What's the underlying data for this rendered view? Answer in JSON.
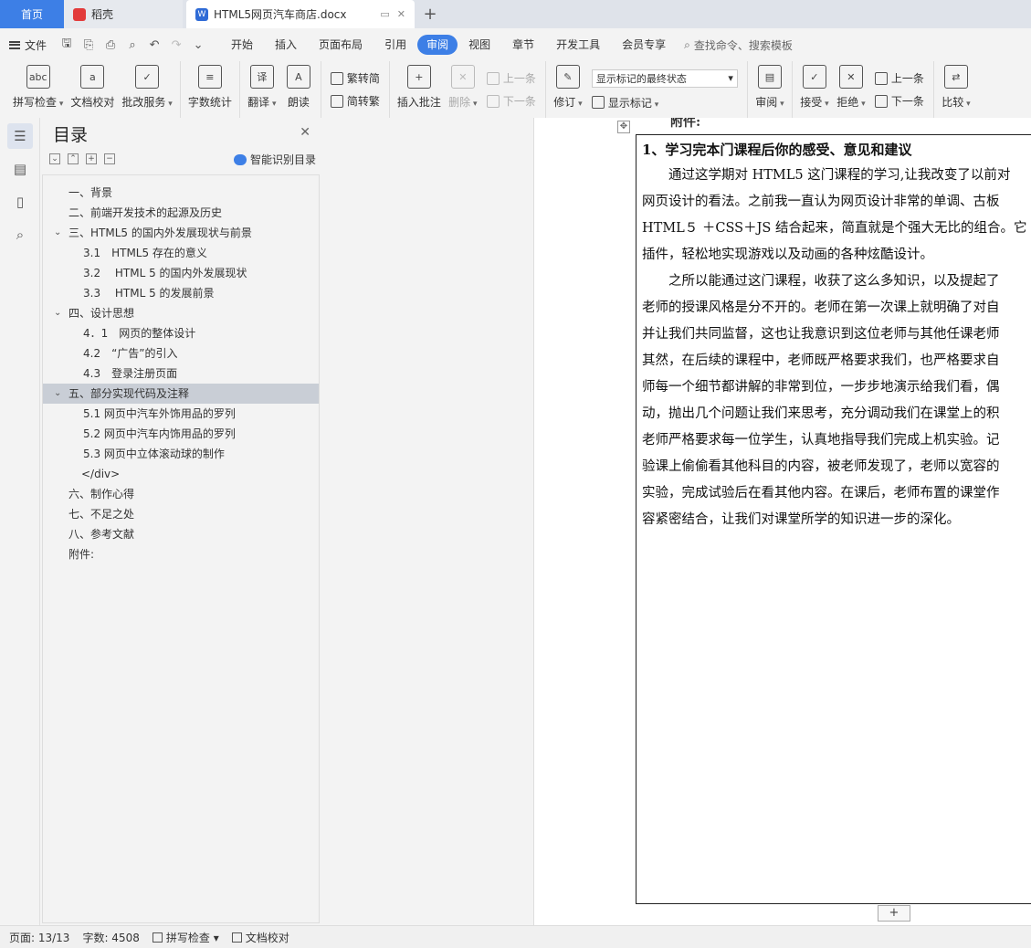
{
  "tabs": {
    "home": "首页",
    "daoke": "稻壳",
    "doc": "HTML5网页汽车商店.docx",
    "plus": "+"
  },
  "menu": {
    "file": "文件",
    "items": [
      "开始",
      "插入",
      "页面布局",
      "引用",
      "审阅",
      "视图",
      "章节",
      "开发工具",
      "会员专享"
    ],
    "active": "审阅",
    "search": "查找命令、搜索模板"
  },
  "ribbon": {
    "spell_check": "拼写检查",
    "doc_proof": "文档校对",
    "batch_service": "批改服务",
    "word_count": "字数统计",
    "translate": "翻译",
    "read_aloud": "朗读",
    "trad_to_simp": "繁转简",
    "simp_to_trad": "简转繁",
    "insert_comment": "插入批注",
    "delete": "删除",
    "prev_comment": "上一条",
    "next_comment": "下一条",
    "revise": "修订",
    "markup_state": "显示标记的最终状态",
    "show_markup": "显示标记",
    "review": "审阅",
    "accept": "接受",
    "reject": "拒绝",
    "prev_change": "上一条",
    "next_change": "下一条",
    "compare": "比较"
  },
  "toc": {
    "title": "目录",
    "smart": "智能识别目录",
    "items": [
      {
        "label": "一、背景",
        "indent": 0,
        "arrow": ""
      },
      {
        "label": "二、前端开发技术的起源及历史",
        "indent": 0,
        "arrow": ""
      },
      {
        "label": "三、HTML5 的国内外发展现状与前景",
        "indent": 0,
        "arrow": "⌄"
      },
      {
        "label": "3.1　HTML5 存在的意义",
        "indent": 1,
        "arrow": ""
      },
      {
        "label": "3.2　 HTML 5 的国内外发展现状",
        "indent": 1,
        "arrow": ""
      },
      {
        "label": "3.3　 HTML 5 的发展前景",
        "indent": 1,
        "arrow": ""
      },
      {
        "label": "四、设计思想",
        "indent": 0,
        "arrow": "⌄"
      },
      {
        "label": "4．1　网页的整体设计",
        "indent": 1,
        "arrow": ""
      },
      {
        "label": "4.2　“广告”的引入",
        "indent": 1,
        "arrow": ""
      },
      {
        "label": "4.3　登录注册页面",
        "indent": 1,
        "arrow": ""
      },
      {
        "label": "五、部分实现代码及注释",
        "indent": 0,
        "arrow": "⌄",
        "selected": true
      },
      {
        "label": "5.1 网页中汽车外饰用品的罗列",
        "indent": 1,
        "arrow": ""
      },
      {
        "label": "5.2 网页中汽车内饰用品的罗列",
        "indent": 1,
        "arrow": ""
      },
      {
        "label": "5.3 网页中立体滚动球的制作",
        "indent": 1,
        "arrow": ""
      },
      {
        "label": "</div>",
        "indent": 2,
        "arrow": ""
      },
      {
        "label": "六、制作心得",
        "indent": 0,
        "arrow": ""
      },
      {
        "label": "七、不足之处",
        "indent": 0,
        "arrow": ""
      },
      {
        "label": "八、参考文献",
        "indent": 0,
        "arrow": ""
      },
      {
        "label": "附件:",
        "indent": 0,
        "arrow": ""
      }
    ]
  },
  "document": {
    "cut_heading": "附件:",
    "heading": "1、学习完本门课程后你的感受、意见和建议",
    "lines": [
      "　　通过这学期对 HTML5 这门课程的学习,让我改变了以前对",
      "网页设计的看法。之前我一直认为网页设计非常的单调、古板",
      "HTML５ ＋CSS＋JS 结合起来，简直就是个强大无比的组合。它",
      "插件，轻松地实现游戏以及动画的各种炫酷设计。",
      "　　之所以能通过这门课程，收获了这么多知识，以及提起了",
      "老师的授课风格是分不开的。老师在第一次课上就明确了对自",
      "并让我们共同监督，这也让我意识到这位老师与其他任课老师",
      "其然，在后续的课程中，老师既严格要求我们，也严格要求自",
      "师每一个细节都讲解的非常到位，一步步地演示给我们看，偶",
      "动，抛出几个问题让我们来思考，充分调动我们在课堂上的积",
      "老师严格要求每一位学生，认真地指导我们完成上机实验。记",
      "验课上偷偷看其他科目的内容，被老师发现了，老师以宽容的",
      "实验，完成试验后在看其他内容。在课后，老师布置的课堂作",
      "容紧密结合，让我们对课堂所学的知识进一步的深化。"
    ],
    "plus": "+"
  },
  "status": {
    "page": "页面: 13/13",
    "words": "字数: 4508",
    "spell": "拼写检查",
    "proof": "文档校对"
  }
}
